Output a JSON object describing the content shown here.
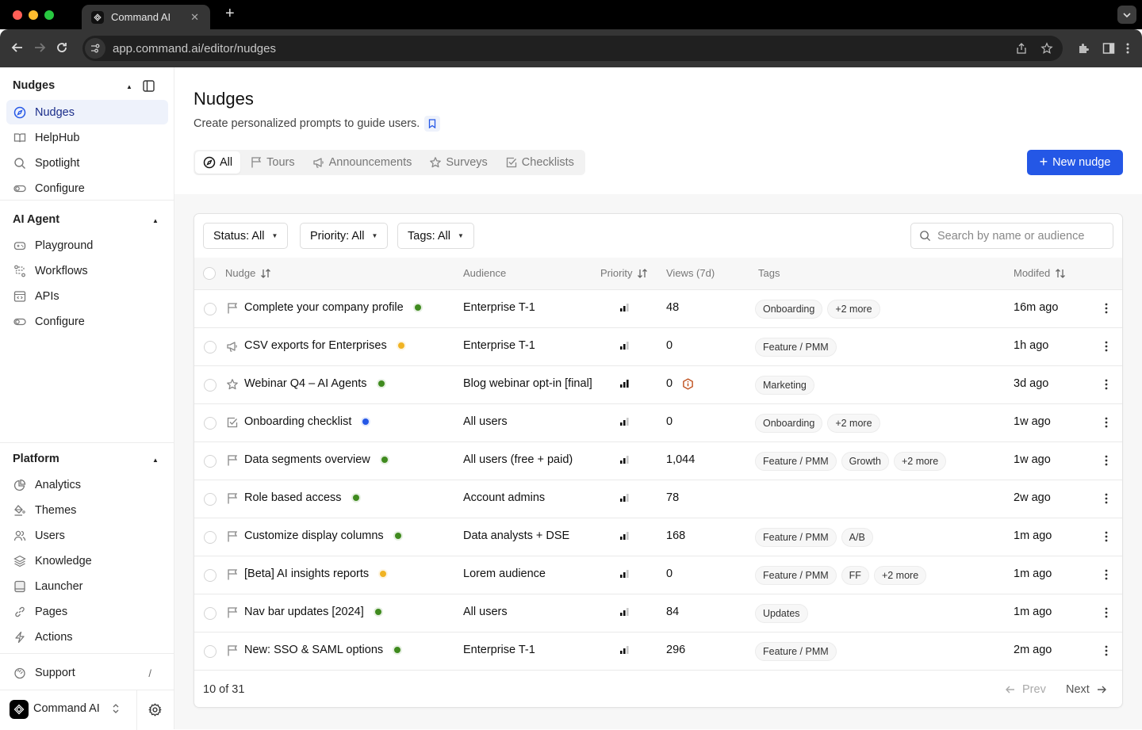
{
  "browser": {
    "tab_title": "Command AI",
    "url": "app.command.ai/editor/nudges",
    "traffic_lights": {
      "close": "#ff5f57",
      "minimize": "#febc2e",
      "maximize": "#28c840"
    }
  },
  "sidebar": {
    "sections": [
      {
        "title": "Nudges",
        "items": [
          {
            "label": "Nudges",
            "icon": "compass-icon",
            "active": true
          },
          {
            "label": "HelpHub",
            "icon": "book-icon"
          },
          {
            "label": "Spotlight",
            "icon": "search-icon"
          },
          {
            "label": "Configure",
            "icon": "toggle-icon"
          }
        ]
      },
      {
        "title": "AI Agent",
        "items": [
          {
            "label": "Playground",
            "icon": "gamepad-icon"
          },
          {
            "label": "Workflows",
            "icon": "route-icon"
          },
          {
            "label": "APIs",
            "icon": "code-window-icon"
          },
          {
            "label": "Configure",
            "icon": "toggle-icon"
          }
        ]
      },
      {
        "title": "Platform",
        "items": [
          {
            "label": "Analytics",
            "icon": "pie-chart-icon"
          },
          {
            "label": "Themes",
            "icon": "paint-bucket-icon"
          },
          {
            "label": "Users",
            "icon": "users-icon"
          },
          {
            "label": "Knowledge",
            "icon": "layers-icon"
          },
          {
            "label": "Launcher",
            "icon": "launcher-icon"
          },
          {
            "label": "Pages",
            "icon": "link-icon"
          },
          {
            "label": "Actions",
            "icon": "lightning-icon"
          }
        ]
      }
    ],
    "support": {
      "label": "Support",
      "shortcut": "/"
    },
    "org": {
      "name": "Command AI"
    }
  },
  "page": {
    "title": "Nudges",
    "subtitle": "Create personalized prompts to guide users.",
    "tabs": [
      {
        "label": "All",
        "icon": "compass-icon",
        "active": true
      },
      {
        "label": "Tours",
        "icon": "flag-icon"
      },
      {
        "label": "Announcements",
        "icon": "megaphone-icon"
      },
      {
        "label": "Surveys",
        "icon": "star-icon"
      },
      {
        "label": "Checklists",
        "icon": "checkbox-icon"
      }
    ],
    "new_button": "New nudge",
    "accent": "#2457e6"
  },
  "filters": {
    "status": "Status: All",
    "priority": "Priority: All",
    "tags": "Tags: All",
    "search_placeholder": "Search by name or audience",
    "search_value": ""
  },
  "table": {
    "columns": {
      "nudge": "Nudge",
      "audience": "Audience",
      "priority": "Priority",
      "views": "Views (7d)",
      "tags": "Tags",
      "modified": "Modifed"
    },
    "status_colors": {
      "live": "#3f8a1e",
      "draft": "#f0b323",
      "scheduled": "#2457e6"
    },
    "rows": [
      {
        "type": "flag",
        "name": "Complete your company profile",
        "status": "live",
        "audience": "Enterprise T-1",
        "priority": 2,
        "views": "48",
        "warning": false,
        "tags": [
          "Onboarding",
          "+2 more"
        ],
        "modified": "16m ago"
      },
      {
        "type": "megaphone",
        "name": "CSV exports for Enterprises",
        "status": "draft",
        "audience": "Enterprise T-1",
        "priority": 2,
        "views": "0",
        "warning": false,
        "tags": [
          "Feature / PMM"
        ],
        "modified": "1h ago"
      },
      {
        "type": "star",
        "name": "Webinar Q4 – AI Agents",
        "status": "live",
        "audience": "Blog webinar opt-in [final]",
        "priority": 3,
        "views": "0",
        "warning": true,
        "tags": [
          "Marketing"
        ],
        "modified": "3d ago"
      },
      {
        "type": "checkbox",
        "name": "Onboarding checklist",
        "status": "scheduled",
        "audience": "All users",
        "priority": 2,
        "views": "0",
        "warning": false,
        "tags": [
          "Onboarding",
          "+2 more"
        ],
        "modified": "1w ago"
      },
      {
        "type": "flag",
        "name": "Data segments overview",
        "status": "live",
        "audience": "All users (free + paid)",
        "priority": 2,
        "views": "1,044",
        "warning": false,
        "tags": [
          "Feature / PMM",
          "Growth",
          "+2 more"
        ],
        "modified": "1w ago"
      },
      {
        "type": "flag",
        "name": "Role based access",
        "status": "live",
        "audience": "Account admins",
        "priority": 2,
        "views": "78",
        "warning": false,
        "tags": [],
        "modified": "2w ago"
      },
      {
        "type": "flag",
        "name": "Customize display columns",
        "status": "live",
        "audience": "Data analysts + DSE",
        "priority": 2,
        "views": "168",
        "warning": false,
        "tags": [
          "Feature / PMM",
          "A/B"
        ],
        "modified": "1m ago"
      },
      {
        "type": "flag",
        "name": "[Beta] AI insights reports",
        "status": "draft",
        "audience": "Lorem audience",
        "priority": 2,
        "views": "0",
        "warning": false,
        "tags": [
          "Feature / PMM",
          "FF",
          "+2 more"
        ],
        "modified": "1m ago"
      },
      {
        "type": "flag",
        "name": "Nav bar updates [2024]",
        "status": "live",
        "audience": "All users",
        "priority": 2,
        "views": "84",
        "warning": false,
        "tags": [
          "Updates"
        ],
        "modified": "1m ago"
      },
      {
        "type": "flag",
        "name": "New: SSO & SAML options",
        "status": "live",
        "audience": "Enterprise T-1",
        "priority": 2,
        "views": "296",
        "warning": false,
        "tags": [
          "Feature / PMM"
        ],
        "modified": "2m ago"
      }
    ]
  },
  "pagination": {
    "summary": "10 of 31",
    "prev": "Prev",
    "next": "Next"
  }
}
